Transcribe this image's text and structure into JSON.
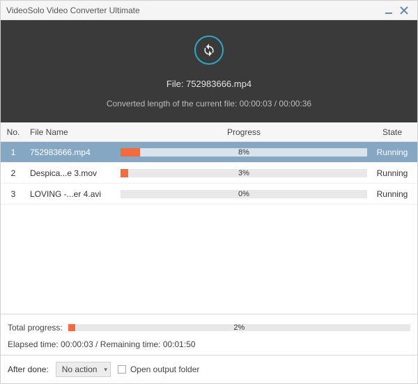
{
  "window": {
    "title": "VideoSolo Video Converter Ultimate"
  },
  "hero": {
    "file_prefix": "File: ",
    "file_name": "752983666.mp4",
    "converted_prefix": "Converted length of the current file: ",
    "time_current": "00:00:03",
    "time_sep": " / ",
    "time_total": "00:00:36"
  },
  "columns": {
    "no": "No.",
    "name": "File Name",
    "progress": "Progress",
    "state": "State"
  },
  "rows": [
    {
      "no": "1",
      "name": "752983666.mp4",
      "percent": 8,
      "percent_label": "8%",
      "state": "Running",
      "selected": true
    },
    {
      "no": "2",
      "name": "Despica...e 3.mov",
      "percent": 3,
      "percent_label": "3%",
      "state": "Running",
      "selected": false
    },
    {
      "no": "3",
      "name": "LOVING -...er 4.avi",
      "percent": 0,
      "percent_label": "0%",
      "state": "Running",
      "selected": false
    }
  ],
  "total": {
    "label": "Total progress:",
    "percent": 2,
    "percent_label": "2%"
  },
  "timing": {
    "elapsed_label": "Elapsed time: ",
    "elapsed": "00:00:03",
    "sep": " / ",
    "remaining_label": "Remaining time: ",
    "remaining": "00:01:50"
  },
  "after": {
    "label": "After done:",
    "selected": "No action",
    "checkbox_label": "Open output folder",
    "checkbox_checked": false
  }
}
